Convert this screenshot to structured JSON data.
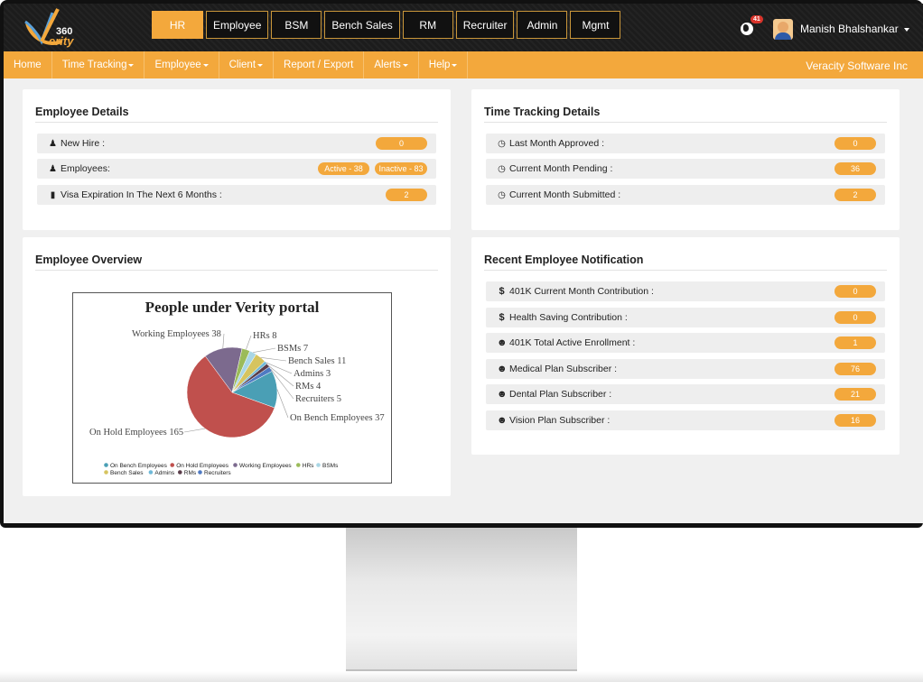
{
  "header": {
    "logo_text": "360 Verity",
    "modules": [
      "HR",
      "Employee",
      "BSM",
      "Bench Sales",
      "RM",
      "Recruiter",
      "Admin",
      "Mgmt"
    ],
    "notification_count": "41",
    "user_name": "Manish Bhalshankar"
  },
  "menubar": {
    "items": [
      "Home",
      "Time Tracking",
      "Employee",
      "Client",
      "Report / Export",
      "Alerts",
      "Help"
    ],
    "company": "Veracity Software Inc"
  },
  "employee_details": {
    "title": "Employee Details",
    "new_hire_label": "New Hire :",
    "new_hire_value": "0",
    "employees_label": "Employees:",
    "active": "Active - 38",
    "inactive": "Inactive - 83",
    "visa_label": "Visa Expiration In The Next 6 Months :",
    "visa_value": "2"
  },
  "time_tracking": {
    "title": "Time Tracking Details",
    "rows": [
      {
        "label": "Last Month Approved :",
        "value": "0"
      },
      {
        "label": "Current Month Pending :",
        "value": "36"
      },
      {
        "label": "Current Month Submitted :",
        "value": "2"
      }
    ]
  },
  "overview": {
    "title": "Employee Overview"
  },
  "notifications": {
    "title": "Recent Employee Notification",
    "rows": [
      {
        "icon": "dollar-icon",
        "label": "401K Current Month Contribution :",
        "value": "0"
      },
      {
        "icon": "dollar-icon",
        "label": "Health Saving Contribution :",
        "value": "0"
      },
      {
        "icon": "users-icon",
        "label": "401K Total Active Enrollment :",
        "value": "1"
      },
      {
        "icon": "users-icon",
        "label": "Medical Plan Subscriber :",
        "value": "76"
      },
      {
        "icon": "users-icon",
        "label": "Dental Plan Subscriber :",
        "value": "21"
      },
      {
        "icon": "users-icon",
        "label": "Vision Plan Subscriber :",
        "value": "16"
      }
    ]
  },
  "colors": {
    "accent": "#f3a83c",
    "topbar": "#1c1c1c"
  },
  "chart_data": {
    "type": "pie",
    "title": "People under Verity portal",
    "series": [
      {
        "name": "On Bench Employees",
        "value": 37,
        "color": "#4a9fb5"
      },
      {
        "name": "On Hold Employees",
        "value": 165,
        "color": "#c0504d"
      },
      {
        "name": "Working Employees",
        "value": 38,
        "color": "#7c6a8e"
      },
      {
        "name": "HRs",
        "value": 8,
        "color": "#9bbb59"
      },
      {
        "name": "BSMs",
        "value": 7,
        "color": "#a9d6e5"
      },
      {
        "name": "Bench Sales",
        "value": 11,
        "color": "#d6c45f"
      },
      {
        "name": "Admins",
        "value": 3,
        "color": "#6fb9d8"
      },
      {
        "name": "RMs",
        "value": 4,
        "color": "#5a3d4a"
      },
      {
        "name": "Recruiters",
        "value": 5,
        "color": "#4f7ac2"
      }
    ],
    "legend_position": "bottom"
  }
}
